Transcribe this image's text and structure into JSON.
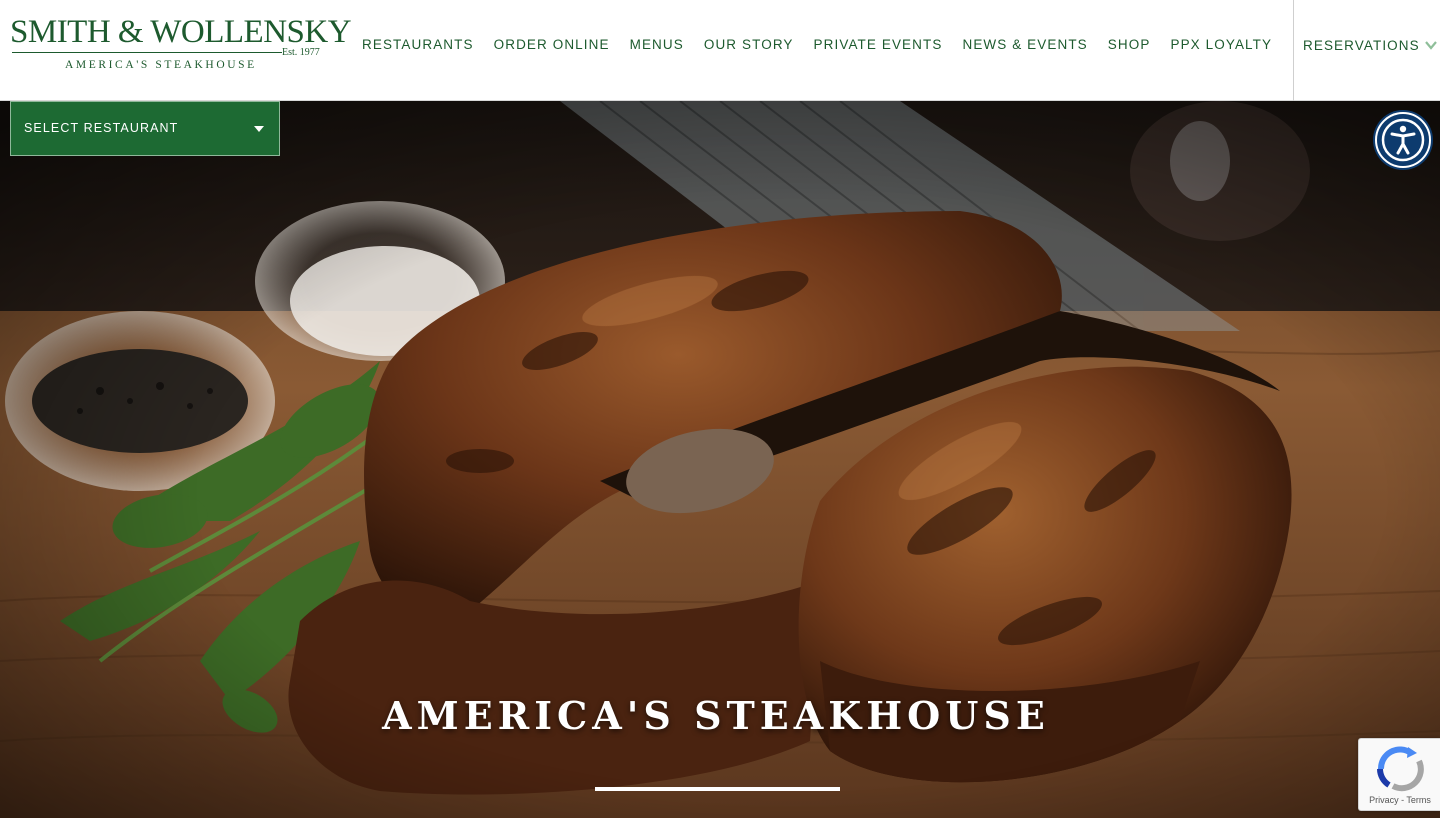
{
  "logo": {
    "name": "SMITH & WOLLENSKY",
    "established": "Est. 1977",
    "tagline": "AMERICA'S STEAKHOUSE"
  },
  "nav": {
    "items": [
      {
        "label": "RESTAURANTS"
      },
      {
        "label": "ORDER ONLINE"
      },
      {
        "label": "MENUS"
      },
      {
        "label": "OUR STORY"
      },
      {
        "label": "PRIVATE EVENTS"
      },
      {
        "label": "NEWS & EVENTS"
      },
      {
        "label": "SHOP"
      },
      {
        "label": "PPX LOYALTY"
      }
    ],
    "reservations": {
      "label": "RESERVATIONS",
      "icon": "chevron-down-icon"
    }
  },
  "restaurant_select": {
    "label": "SELECT RESTAURANT",
    "icon": "caret-down-icon"
  },
  "accessibility": {
    "icon": "accessibility-icon"
  },
  "hero": {
    "title": "AMERICA'S STEAKHOUSE",
    "image": "porterhouse steak on wooden board with parsley and peppercorns"
  },
  "recaptcha": {
    "text": "Privacy - Terms",
    "icon": "recaptcha-icon"
  },
  "colors": {
    "brand_green": "#1d5a2e",
    "select_green": "#1d6a33",
    "accessibility_blue": "#0d3b6e",
    "white": "#ffffff"
  }
}
